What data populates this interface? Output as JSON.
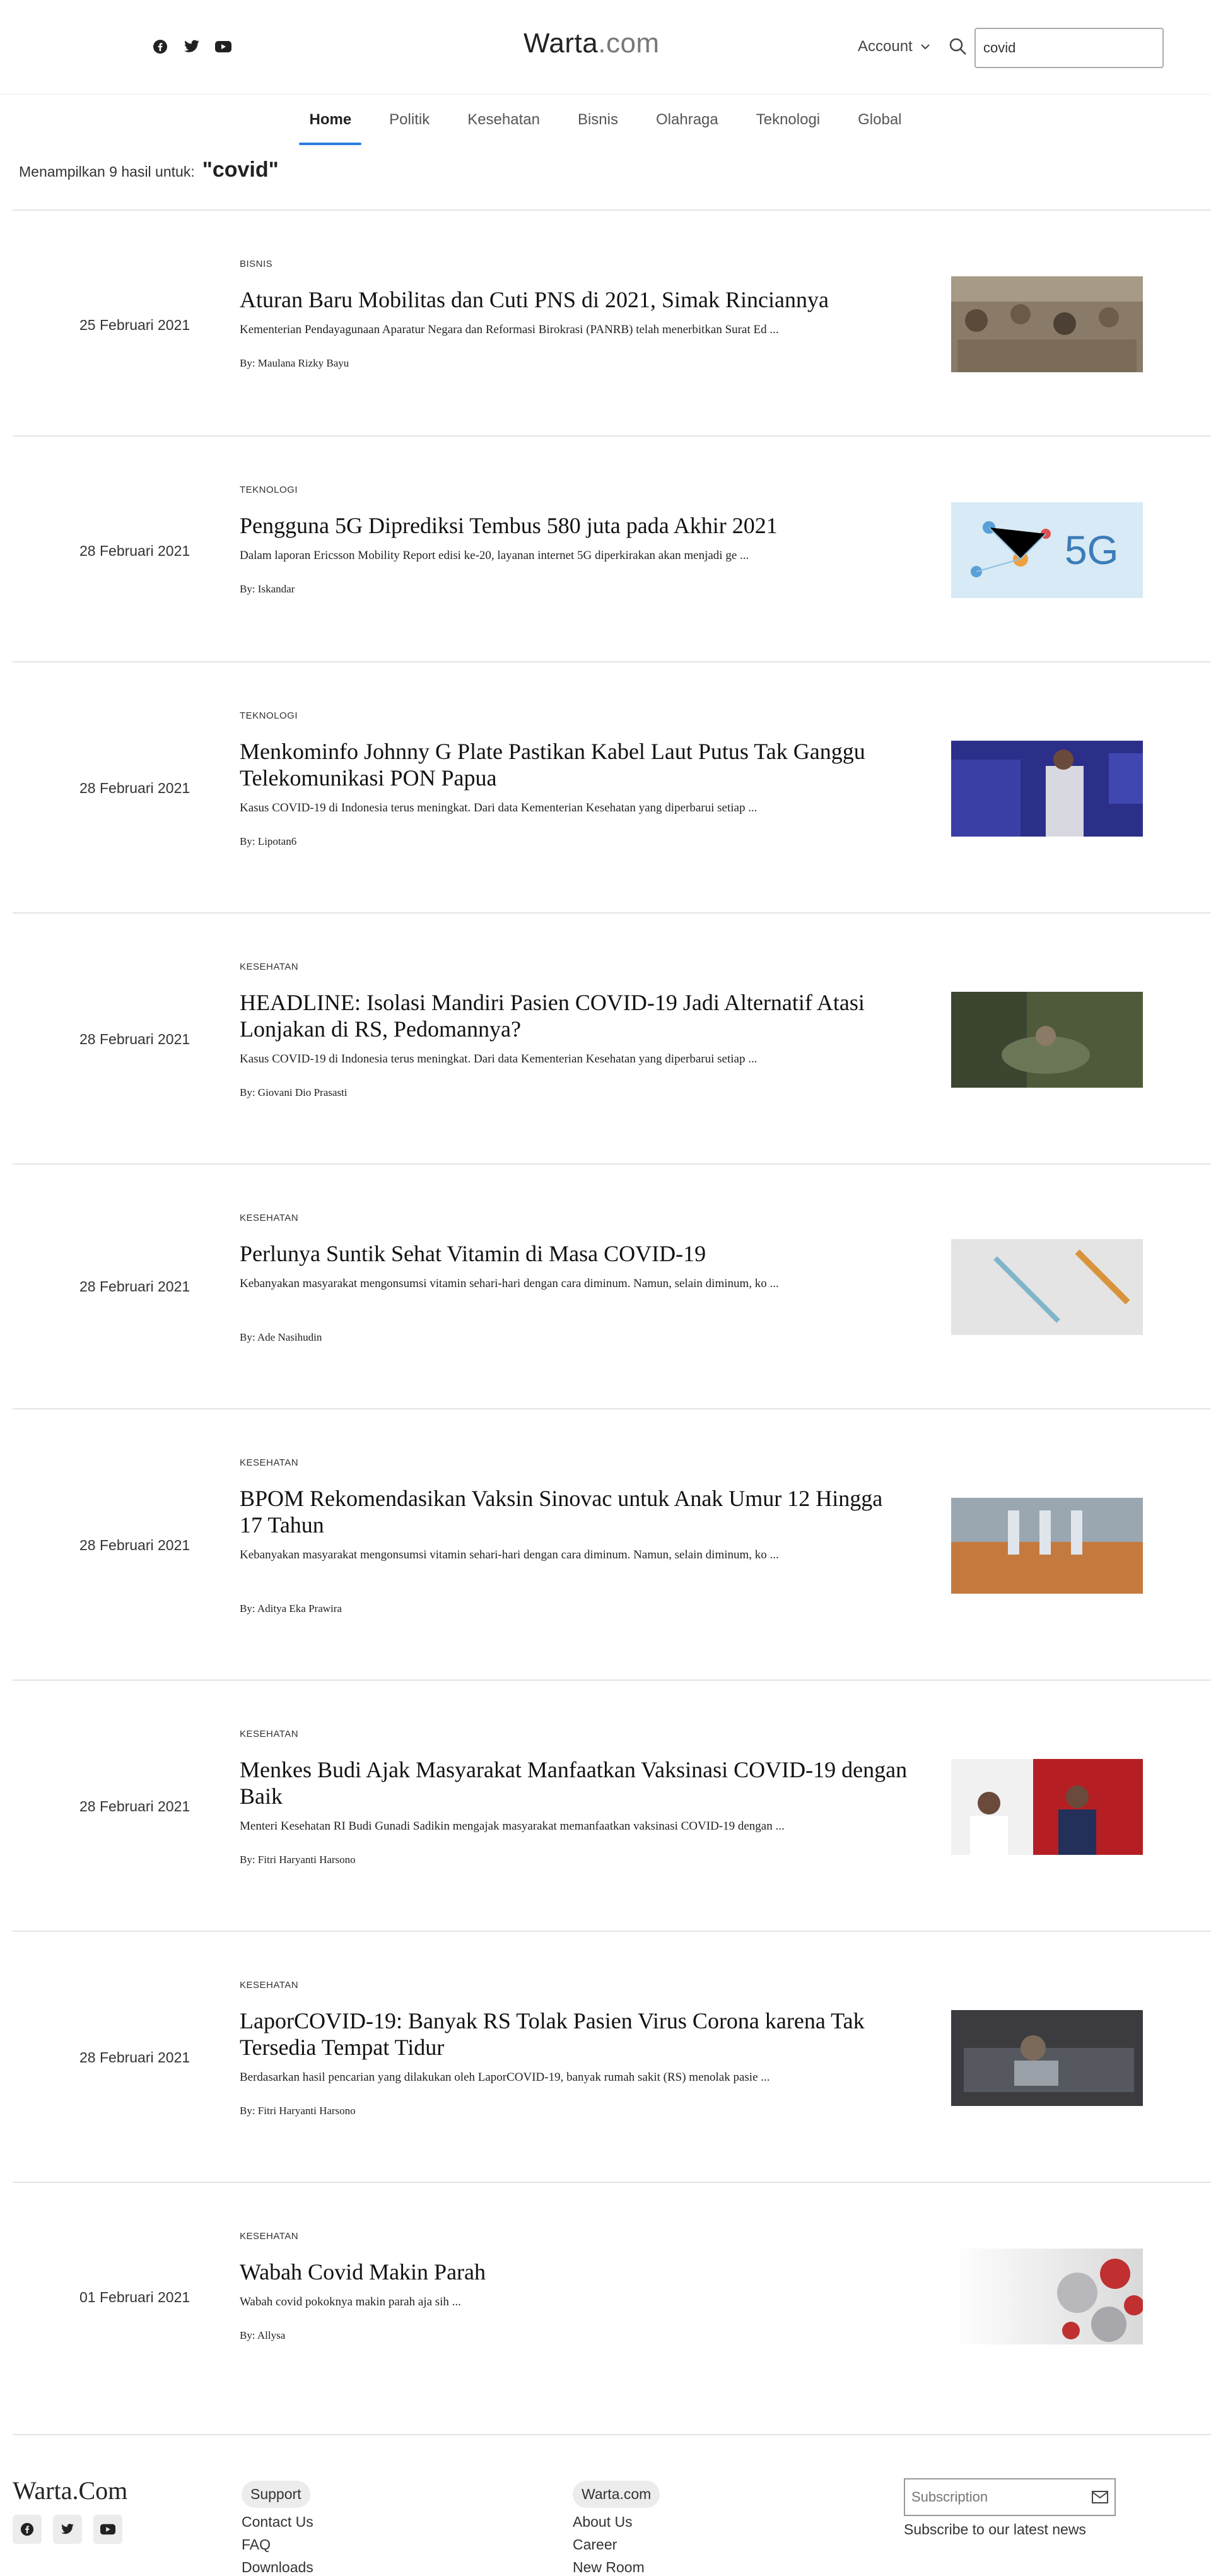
{
  "header": {
    "logo_main": "Warta",
    "logo_suffix": ".com",
    "account_label": "Account",
    "search_value": "covid"
  },
  "nav": {
    "tabs": [
      {
        "label": "Home"
      },
      {
        "label": "Politik"
      },
      {
        "label": "Kesehatan"
      },
      {
        "label": "Bisnis"
      },
      {
        "label": "Olahraga"
      },
      {
        "label": "Teknologi"
      },
      {
        "label": "Global"
      }
    ],
    "active": "Home"
  },
  "results": {
    "prefix": "Menampilkan 9 hasil untuk:",
    "query": "\"covid\""
  },
  "articles": [
    {
      "date": "25 Februari 2021",
      "category": "BISNIS",
      "title": "Aturan Baru Mobilitas dan Cuti PNS di 2021, Simak Rinciannya",
      "excerpt": "Kementerian Pendayagunaan Aparatur Negara dan Reformasi Birokrasi (PANRB) telah menerbitkan Surat Ed ...",
      "author": "By: Maulana Rizky Bayu",
      "thumb_color": "#8a7a68"
    },
    {
      "date": "28 Februari 2021",
      "category": "TEKNOLOGI",
      "title": "Pengguna 5G Diprediksi Tembus 580 juta pada Akhir 2021",
      "excerpt": "Dalam laporan Ericsson Mobility Report edisi ke-20, layanan internet 5G diperkirakan akan menjadi ge ...",
      "author": "By: Iskandar",
      "thumb_color": "#d7eaf5"
    },
    {
      "date": "28 Februari 2021",
      "category": "TEKNOLOGI",
      "title": "Menkominfo Johnny G Plate Pastikan Kabel Laut Putus Tak Ganggu Telekomunikasi PON Papua",
      "excerpt": "Kasus COVID-19 di Indonesia terus meningkat. Dari data Kementerian Kesehatan yang diperbarui setiap ...",
      "author": "By: Lipotan6",
      "thumb_color": "#2b2f8a"
    },
    {
      "date": "28 Februari 2021",
      "category": "KESEHATAN",
      "title": "HEADLINE: Isolasi Mandiri Pasien COVID-19 Jadi Alternatif Atasi Lonjakan di RS, Pedomannya?",
      "excerpt": "Kasus COVID-19 di Indonesia terus meningkat. Dari data Kementerian Kesehatan yang diperbarui setiap ...",
      "author": "By: Giovani Dio Prasasti",
      "thumb_color": "#4f5a3a"
    },
    {
      "date": "28 Februari 2021",
      "category": "KESEHATAN",
      "title": "Perlunya Suntik Sehat Vitamin di Masa COVID-19",
      "excerpt": "Kebanyakan masyarakat mengonsumsi vitamin sehari-hari dengan cara diminum. Namun, selain diminum, ko ...",
      "author": "By: Ade Nasihudin",
      "thumb_color": "#e4e4e4"
    },
    {
      "date": "28 Februari 2021",
      "category": "KESEHATAN",
      "title": "BPOM Rekomendasikan Vaksin Sinovac untuk Anak Umur 12 Hingga 17 Tahun",
      "excerpt": "Kebanyakan masyarakat mengonsumsi vitamin sehari-hari dengan cara diminum. Namun, selain diminum, ko ...",
      "author": "By: Aditya Eka Prawira",
      "thumb_color": "#c47a3e"
    },
    {
      "date": "28 Februari 2021",
      "category": "KESEHATAN",
      "title": "Menkes Budi Ajak Masyarakat Manfaatkan Vaksinasi COVID-19 dengan Baik",
      "excerpt": "Menteri Kesehatan RI Budi Gunadi Sadikin mengajak masyarakat memanfaatkan vaksinasi COVID-19 dengan ...",
      "author": "By: Fitri Haryanti Harsono",
      "thumb_color": "#b51f24"
    },
    {
      "date": "28 Februari 2021",
      "category": "KESEHATAN",
      "title": "LaporCOVID-19: Banyak RS Tolak Pasien Virus Corona karena Tak Tersedia Tempat Tidur",
      "excerpt": "Berdasarkan hasil pencarian yang dilakukan oleh LaporCOVID-19, banyak rumah sakit (RS) menolak pasie ...",
      "author": "By: Fitri Haryanti Harsono",
      "thumb_color": "#3c3c40"
    },
    {
      "date": "01 Februari 2021",
      "category": "KESEHATAN",
      "title": "Wabah Covid Makin Parah",
      "excerpt": "Wabah covid pokoknya makin parah aja sih ...",
      "author": "By: Allysa",
      "thumb_color": "#eeeeee"
    }
  ],
  "footer": {
    "brand": "Warta.Com",
    "col1": {
      "heading": "Support",
      "links": [
        "Contact Us",
        "FAQ",
        "Downloads"
      ]
    },
    "col2": {
      "heading": "Warta.com",
      "links": [
        "About Us",
        "Career",
        "New Room"
      ]
    },
    "subscription_placeholder": "Subscription",
    "subscribe_text": "Subscribe to our latest news"
  }
}
